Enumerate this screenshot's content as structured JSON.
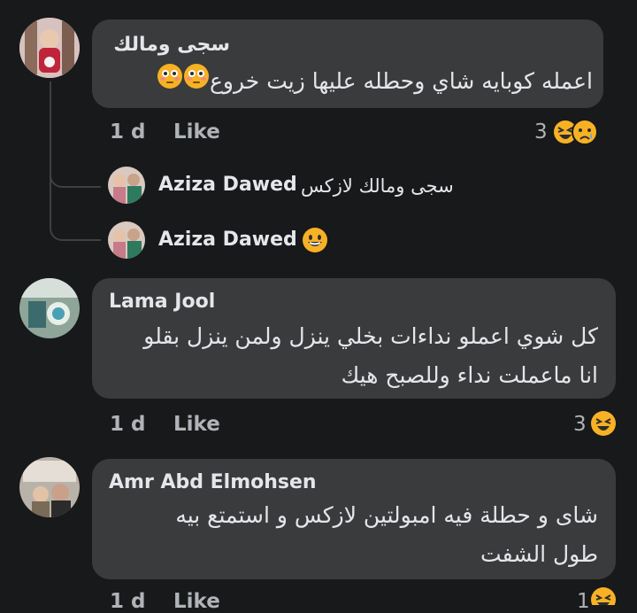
{
  "comments": [
    {
      "author": "سجى ومالك",
      "text": "اعمله كوبايه شاي وحطله عليها زيت خروع",
      "time": "1 d",
      "like": "Like",
      "reaction_count": "3",
      "reactions": [
        "grinning-squinting-face-icon",
        "sad-face-icon"
      ],
      "inline_emojis": [
        "flushed-face-icon",
        "flushed-face-icon"
      ],
      "replies": [
        {
          "author": "Aziza Dawed",
          "text": "سجى ومالك لازكس"
        },
        {
          "author": "Aziza Dawed",
          "text": "",
          "emoji": "grinning-face-icon"
        }
      ]
    },
    {
      "author": "Lama Jool",
      "lines": [
        "كل شوي اعملو نداءات بخلي ينزل ولمن ينزل بقلو",
        "انا ماعملت نداء وللصبح هيك"
      ],
      "time": "1 d",
      "like": "Like",
      "reaction_count": "3",
      "reactions": [
        "grinning-squinting-face-icon"
      ]
    },
    {
      "author": "Amr Abd Elmohsen",
      "lines": [
        "شاى و حطلة فيه امبولتين لازكس و استمتع بيه",
        "طول الشفت"
      ],
      "time": "1 d",
      "like": "Like",
      "reaction_count": "1",
      "reactions": [
        "grinning-squinting-face-icon"
      ]
    }
  ],
  "colors": {
    "background": "#18191a",
    "bubble": "#3a3b3c",
    "text": "#e4e6eb",
    "secondary": "#b0b3b8",
    "emoji": "#f7b125"
  }
}
